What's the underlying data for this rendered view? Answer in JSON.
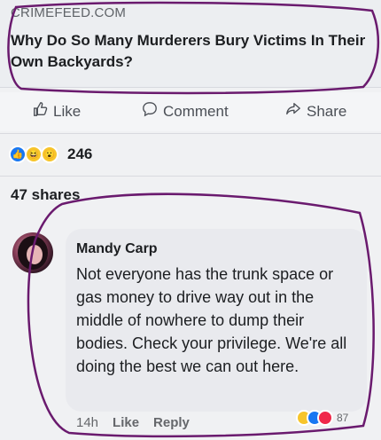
{
  "link_preview": {
    "domain": "CRIMEFEED.COM",
    "headline": "Why Do So Many Murderers Bury Victims In Their Own Backyards?"
  },
  "actions": {
    "like": "Like",
    "comment": "Comment",
    "share": "Share"
  },
  "reactions": {
    "count": "246",
    "types": [
      "like-icon",
      "haha-icon",
      "wow-icon"
    ]
  },
  "shares_text": "47 shares",
  "comment": {
    "author": "Mandy Carp",
    "text": "Not everyone has the trunk space or gas money to drive way out in the middle of nowhere to dump their bodies. Check your privilege. We're all doing the best we can out here.",
    "time": "14h",
    "like": "Like",
    "reply": "Reply",
    "reaction_count": "87",
    "reaction_types": [
      "haha-icon",
      "like-icon",
      "love-icon"
    ]
  },
  "colors": {
    "like_blue": "#1877f2",
    "love_red": "#f0284a",
    "haha_yellow": "#f7c52b",
    "annotation_ink": "#6a1a6e"
  }
}
